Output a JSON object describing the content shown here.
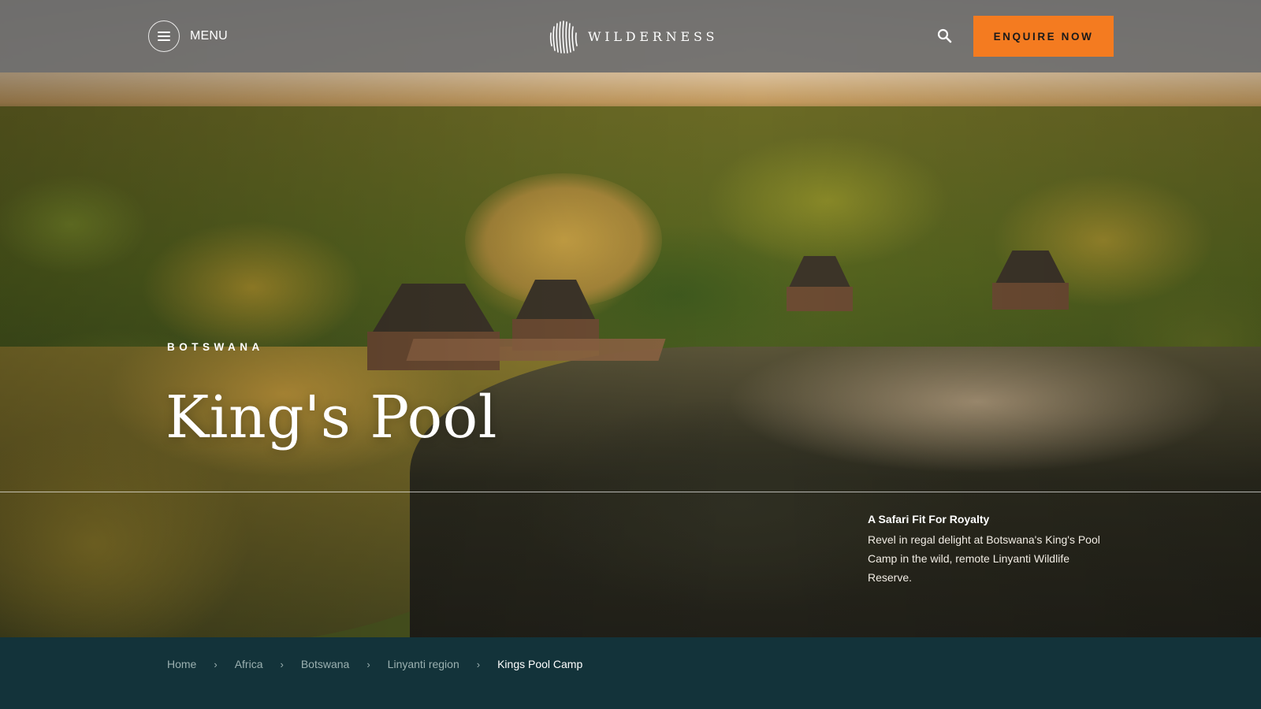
{
  "header": {
    "menu_label": "MENU",
    "brand_name": "WILDERNESS",
    "enquire_label": "ENQUIRE NOW",
    "accent_color": "#f47b20"
  },
  "hero": {
    "country": "BOTSWANA",
    "title": "King's Pool",
    "tagline_title": "A Safari Fit For Royalty",
    "tagline_body": "Revel in regal delight at Botswana's King's Pool Camp in the wild, remote Linyanti Wildlife Reserve."
  },
  "breadcrumb": {
    "items": [
      {
        "label": "Home"
      },
      {
        "label": "Africa"
      },
      {
        "label": "Botswana"
      },
      {
        "label": "Linyanti region"
      },
      {
        "label": "Kings Pool Camp"
      }
    ],
    "separator": "›"
  },
  "icons": {
    "menu": "hamburger-icon",
    "logo": "wilderness-logo-icon",
    "search": "search-icon"
  },
  "colors": {
    "breadcrumb_bg": "#13333a",
    "header_bg": "#6e6e6e"
  }
}
